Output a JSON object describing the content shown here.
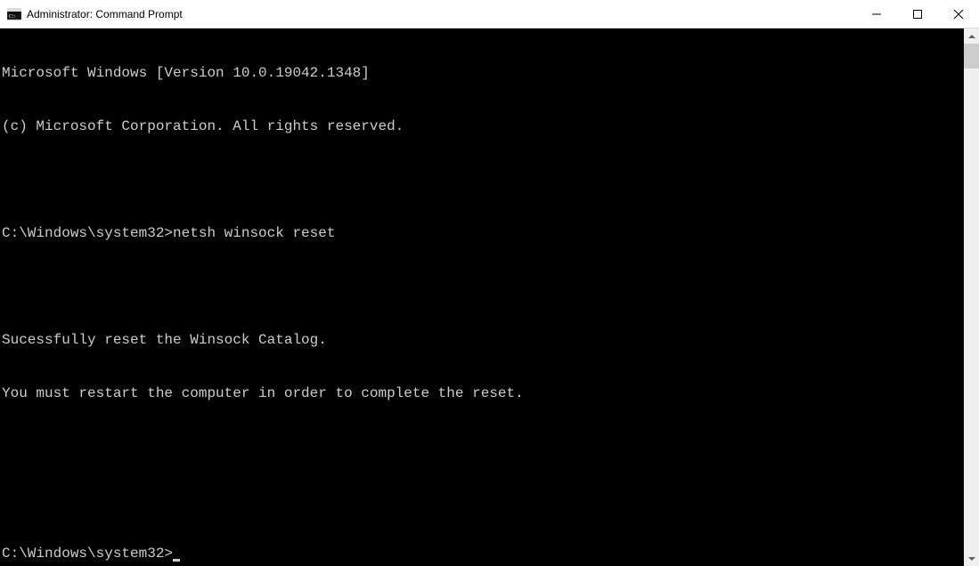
{
  "window": {
    "title": "Administrator: Command Prompt"
  },
  "console": {
    "line1": "Microsoft Windows [Version 10.0.19042.1348]",
    "line2": "(c) Microsoft Corporation. All rights reserved.",
    "blank1": "",
    "prompt1_path": "C:\\Windows\\system32>",
    "prompt1_cmd": "netsh winsock reset",
    "blank2": "",
    "result1": "Sucessfully reset the Winsock Catalog.",
    "result2": "You must restart the computer in order to complete the reset.",
    "blank3": "",
    "blank4": "",
    "prompt2_path": "C:\\Windows\\system32>"
  }
}
